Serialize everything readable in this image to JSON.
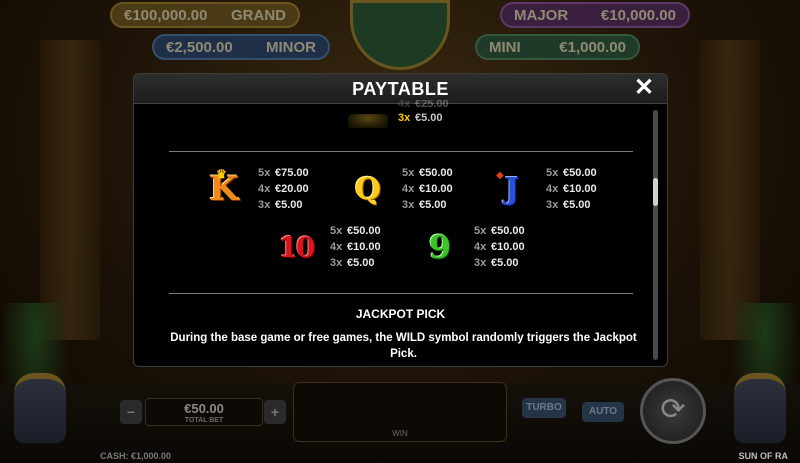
{
  "background": {
    "jackpots": {
      "grand": {
        "value": "€100,000.00",
        "label": "GRAND"
      },
      "major": {
        "label": "MAJOR",
        "value": "€10,000.00"
      },
      "minor": {
        "value": "€2,500.00",
        "label": "MINOR"
      },
      "mini": {
        "label": "MINI",
        "value": "€1,000.00"
      }
    },
    "total_bet": {
      "value": "€50.00",
      "label": "TOTAL BET"
    },
    "bet_minus": "−",
    "bet_plus": "+",
    "win_label": "WIN",
    "turbo_label": "TURBO",
    "auto_label": "AUTO",
    "cash": "CASH: €1,000.00",
    "brand": "SUN OF RA"
  },
  "paytable": {
    "title": "PAYTABLE",
    "close_icon": "close-icon",
    "partial_rows": [
      {
        "mult": "4x",
        "amount": "€25.00"
      },
      {
        "mult": "3x",
        "amount": "€5.00"
      }
    ],
    "symbols_row1": [
      {
        "symbol": "K",
        "icon": "king-symbol-icon",
        "pays": [
          {
            "mult": "5x",
            "amount": "€75.00"
          },
          {
            "mult": "4x",
            "amount": "€20.00"
          },
          {
            "mult": "3x",
            "amount": "€5.00"
          }
        ]
      },
      {
        "symbol": "Q",
        "icon": "queen-symbol-icon",
        "pays": [
          {
            "mult": "5x",
            "amount": "€50.00"
          },
          {
            "mult": "4x",
            "amount": "€10.00"
          },
          {
            "mult": "3x",
            "amount": "€5.00"
          }
        ]
      },
      {
        "symbol": "J",
        "icon": "jack-symbol-icon",
        "pays": [
          {
            "mult": "5x",
            "amount": "€50.00"
          },
          {
            "mult": "4x",
            "amount": "€10.00"
          },
          {
            "mult": "3x",
            "amount": "€5.00"
          }
        ]
      }
    ],
    "symbols_row2": [
      {
        "symbol": "10",
        "icon": "ten-symbol-icon",
        "pays": [
          {
            "mult": "5x",
            "amount": "€50.00"
          },
          {
            "mult": "4x",
            "amount": "€10.00"
          },
          {
            "mult": "3x",
            "amount": "€5.00"
          }
        ]
      },
      {
        "symbol": "9",
        "icon": "nine-symbol-icon",
        "pays": [
          {
            "mult": "5x",
            "amount": "€50.00"
          },
          {
            "mult": "4x",
            "amount": "€10.00"
          },
          {
            "mult": "3x",
            "amount": "€5.00"
          }
        ]
      }
    ],
    "jackpot_section": {
      "title": "JACKPOT PICK",
      "text": "During the base game or free games, the WILD symbol randomly triggers the Jackpot Pick."
    }
  }
}
